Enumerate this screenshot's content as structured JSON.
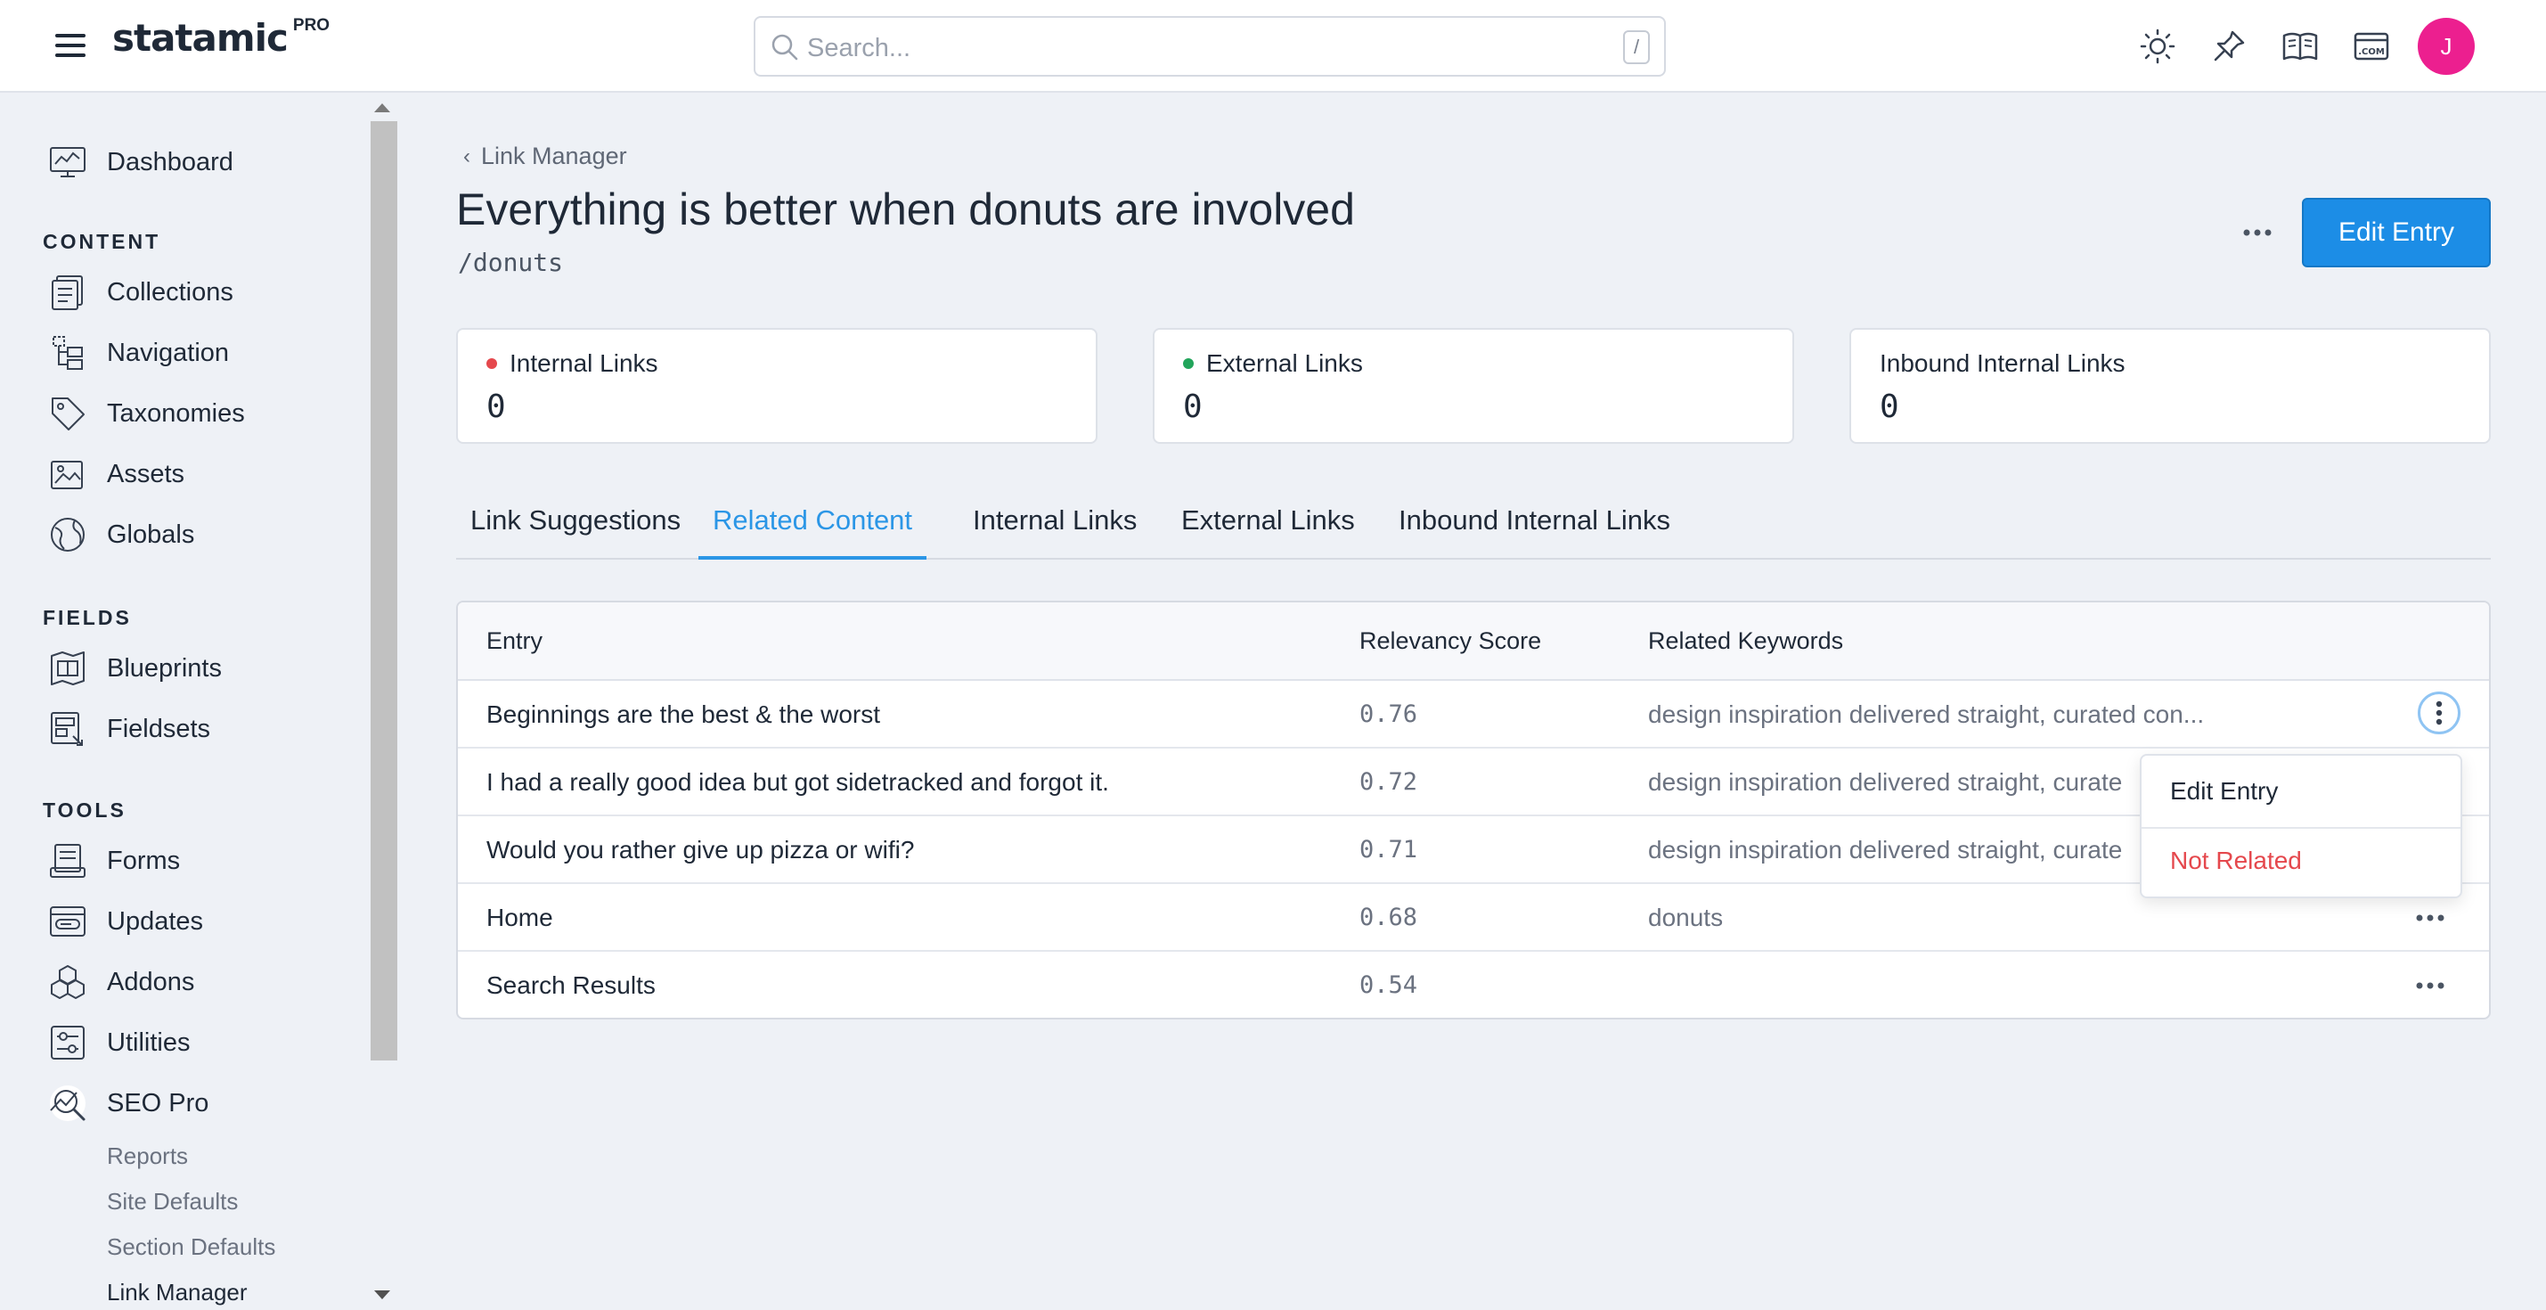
{
  "brand": {
    "name": "statamic",
    "tier": "PRO"
  },
  "search": {
    "placeholder": "Search...",
    "shortcut": "/"
  },
  "user": {
    "initial": "J",
    "avatar_color": "#ec1f8f"
  },
  "sidebar": {
    "top": [
      {
        "label": "Dashboard",
        "icon": "dashboard-icon"
      }
    ],
    "sections": [
      {
        "heading": "CONTENT",
        "items": [
          {
            "label": "Collections",
            "icon": "collections-icon"
          },
          {
            "label": "Navigation",
            "icon": "navigation-icon"
          },
          {
            "label": "Taxonomies",
            "icon": "tag-icon"
          },
          {
            "label": "Assets",
            "icon": "assets-icon"
          },
          {
            "label": "Globals",
            "icon": "globe-icon"
          }
        ]
      },
      {
        "heading": "FIELDS",
        "items": [
          {
            "label": "Blueprints",
            "icon": "blueprint-icon"
          },
          {
            "label": "Fieldsets",
            "icon": "fieldset-icon"
          }
        ]
      },
      {
        "heading": "TOOLS",
        "items": [
          {
            "label": "Forms",
            "icon": "forms-icon"
          },
          {
            "label": "Updates",
            "icon": "updates-icon"
          },
          {
            "label": "Addons",
            "icon": "addons-icon"
          },
          {
            "label": "Utilities",
            "icon": "utilities-icon"
          },
          {
            "label": "SEO Pro",
            "icon": "seo-pro-icon"
          }
        ]
      }
    ],
    "seo_sub": [
      "Reports",
      "Site Defaults",
      "Section Defaults",
      "Link Manager"
    ]
  },
  "page": {
    "breadcrumb": "Link Manager",
    "title": "Everything is better when donuts are involved",
    "slug": "/donuts",
    "edit_button": "Edit Entry"
  },
  "stats": [
    {
      "label": "Internal Links",
      "value": "0",
      "dot_color": "#e5484d"
    },
    {
      "label": "External Links",
      "value": "0",
      "dot_color": "#22a55b"
    },
    {
      "label": "Inbound Internal Links",
      "value": "0",
      "dot_color": ""
    }
  ],
  "tabs": [
    "Link Suggestions",
    "Related Content",
    "Internal Links",
    "External Links",
    "Inbound Internal Links"
  ],
  "active_tab": "Related Content",
  "table": {
    "headers": [
      "Entry",
      "Relevancy Score",
      "Related Keywords"
    ],
    "rows": [
      {
        "entry": "Beginnings are the best & the worst",
        "score": "0.76",
        "keywords": "design inspiration delivered straight, curated con..."
      },
      {
        "entry": "I had a really good idea but got sidetracked and forgot it.",
        "score": "0.72",
        "keywords": "design inspiration delivered straight, curate"
      },
      {
        "entry": "Would you rather give up pizza or wifi?",
        "score": "0.71",
        "keywords": "design inspiration delivered straight, curate"
      },
      {
        "entry": "Home",
        "score": "0.68",
        "keywords": "donuts"
      },
      {
        "entry": "Search Results",
        "score": "0.54",
        "keywords": ""
      }
    ]
  },
  "row_menu": {
    "edit": "Edit Entry",
    "not_related": "Not Related",
    "danger_color": "#e5484d"
  },
  "colors": {
    "accent": "#1c8de6",
    "tab_active": "#2b96e6"
  }
}
